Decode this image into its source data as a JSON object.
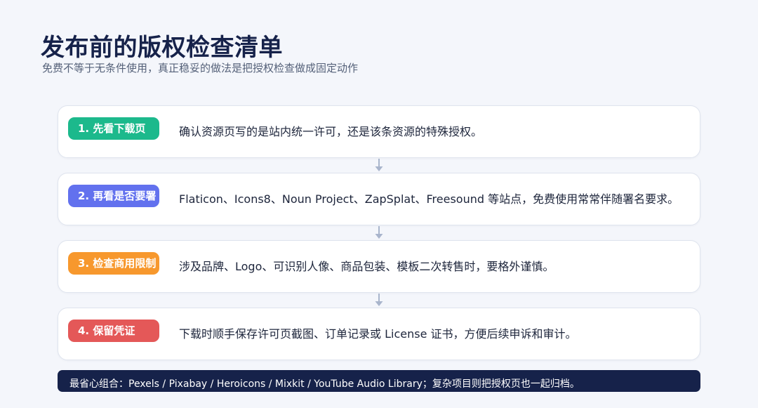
{
  "header": {
    "title": "发布前的版权检查清单",
    "subtitle": "免费不等于无条件使用，真正稳妥的做法是把授权检查做成固定动作"
  },
  "steps": [
    {
      "label": "1. 先看下载页",
      "text": "确认资源页写的是站内统一许可，还是该条资源的特殊授权。",
      "color": "#1cb98c"
    },
    {
      "label": "2. 再看是否要署",
      "text": "Flaticon、Icons8、Noun Project、ZapSplat、Freesound 等站点，免费使用常常伴随署名要求。",
      "color": "#6271ee"
    },
    {
      "label": "3. 检查商用限制",
      "text": "涉及品牌、Logo、可识别人像、商品包装、模板二次转售时，要格外谨慎。",
      "color": "#f7982d"
    },
    {
      "label": "4. 保留凭证",
      "text": "下载时顺手保存许可页截图、订单记录或 License 证书，方便后续申诉和审计。",
      "color": "#e45858"
    }
  ],
  "footer": {
    "text": "最省心组合：Pexels / Pixabay / Heroicons / Mixkit / YouTube Audio Library；复杂项目则把授权页也一起归档。"
  },
  "colors": {
    "title": "#16224a",
    "connector": "#a9b5cc",
    "footer_bg": "#16224a"
  },
  "icons": {
    "connector": "arrow-down-icon"
  }
}
